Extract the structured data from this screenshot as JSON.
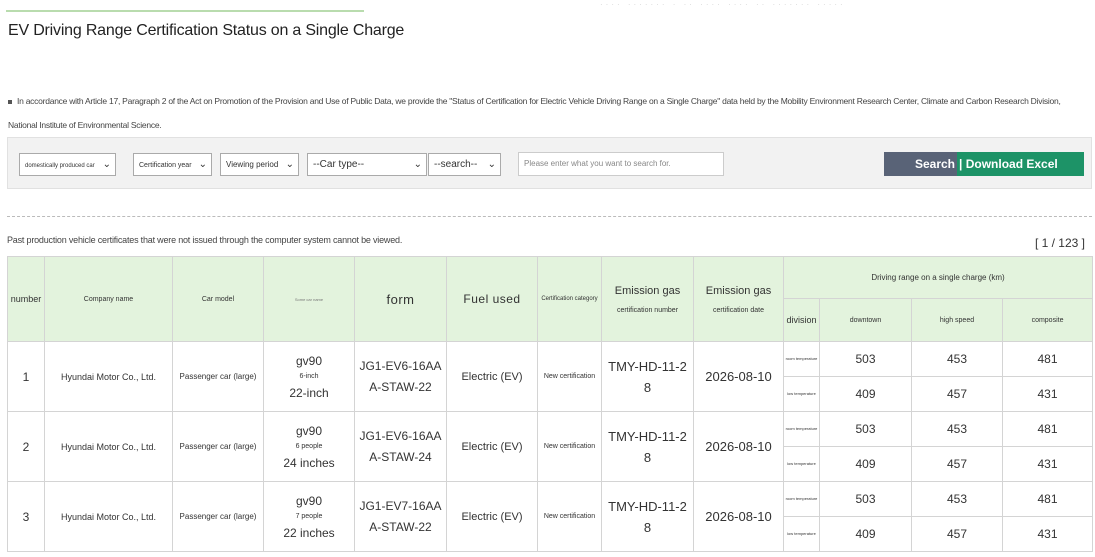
{
  "header": {
    "faint_text": "···· ······· · ·· ···· ···· ·· ······· ·····",
    "page_title": "EV Driving Range Certification Status on a Single Charge",
    "notice_line1": "In accordance with Article 17, Paragraph 2 of the Act on Promotion of the Provision and Use of Public Data, we provide the \"Status of Certification for Electric Vehicle Driving Range on a Single Charge\" data held by the Mobility Environment Research Center, Climate",
    "notice_line2": "and Carbon Research Division, National Institute of Environmental Science."
  },
  "search": {
    "filter_origin": "domestically produced car",
    "filter_year": "Certification year",
    "filter_period": "Viewing period",
    "filter_car_type": "--Car type--",
    "filter_search_field": "--search--",
    "search_placeholder": "Please enter what you want to search for.",
    "search_button": "Search",
    "excel_button": "Download Excel"
  },
  "results": {
    "past_note": "Past production vehicle certificates that were not issued through the computer system cannot be viewed.",
    "pagination": "[ 1 / 123 ]"
  },
  "table": {
    "headers": {
      "number": "number",
      "company": "Company name",
      "model": "Car model",
      "car_name": "Some car name",
      "form": "form",
      "fuel": "Fuel used",
      "cert_category": "Certification category",
      "emission_number": "Emission gas",
      "emission_number_sub": "certification number",
      "emission_date": "Emission gas",
      "emission_date_sub": "certification date",
      "driving_range": "Driving range on a single charge (km)",
      "division": "division",
      "downtown": "downtown",
      "high_speed": "high speed",
      "composite": "composite"
    },
    "rows": [
      {
        "number": "1",
        "company": "Hyundai Motor Co., Ltd.",
        "model": "Passenger car (large)",
        "car_name": "gv90",
        "car_trim": "6-inch",
        "car_wheel": "22-inch",
        "form_line1": "JG1-EV6-16AA",
        "form_line2": "A-STAW-22",
        "fuel": "Electric (EV)",
        "cert_category": "New certification",
        "emission_line1": "TMY-HD-11-2",
        "emission_line2": "8",
        "emission_date": "2026-08-10",
        "div1": "room temperature",
        "div2": "low temperature",
        "downtown1": "503",
        "high1": "453",
        "comp1": "481",
        "downtown2": "409",
        "high2": "457",
        "comp2": "431"
      },
      {
        "number": "2",
        "company": "Hyundai Motor Co., Ltd.",
        "model": "Passenger car (large)",
        "car_name": "gv90",
        "car_trim": "6 people",
        "car_wheel": "24 inches",
        "form_line1": "JG1-EV6-16AA",
        "form_line2": "A-STAW-24",
        "fuel": "Electric (EV)",
        "cert_category": "New certification",
        "emission_line1": "TMY-HD-11-2",
        "emission_line2": "8",
        "emission_date": "2026-08-10",
        "div1": "room temperature",
        "div2": "low temperature",
        "downtown1": "503",
        "high1": "453",
        "comp1": "481",
        "downtown2": "409",
        "high2": "457",
        "comp2": "431"
      },
      {
        "number": "3",
        "company": "Hyundai Motor Co., Ltd.",
        "model": "Passenger car (large)",
        "car_name": "gv90",
        "car_trim": "7 people",
        "car_wheel": "22 inches",
        "form_line1": "JG1-EV7-16AA",
        "form_line2": "A-STAW-22",
        "fuel": "Electric (EV)",
        "cert_category": "New certification",
        "emission_line1": "TMY-HD-11-2",
        "emission_line2": "8",
        "emission_date": "2026-08-10",
        "div1": "room temperature",
        "div2": "low temperature",
        "downtown1": "503",
        "high1": "453",
        "comp1": "481",
        "downtown2": "409",
        "high2": "457",
        "comp2": "431"
      }
    ]
  },
  "icons": {
    "dropdown": "chevron-down-icon",
    "bullet": "bullet-icon"
  },
  "colors": {
    "header_bg": "#e3f3dd",
    "search_button": "#596377",
    "excel_button": "#1d9367",
    "accent_line": "#b9dcae"
  }
}
